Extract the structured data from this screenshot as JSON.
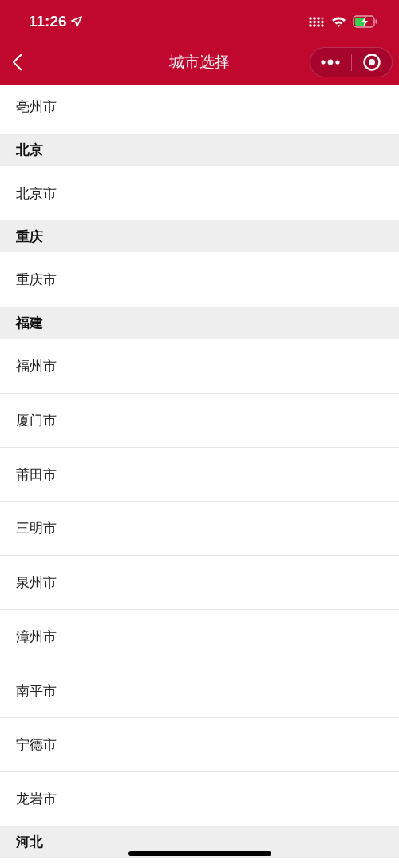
{
  "status_bar": {
    "time": "11:26"
  },
  "nav": {
    "title": "城市选择"
  },
  "groups": [
    {
      "cities": [
        "亳州市"
      ]
    },
    {
      "province": "北京",
      "cities": [
        "北京市"
      ]
    },
    {
      "province": "重庆",
      "cities": [
        "重庆市"
      ]
    },
    {
      "province": "福建",
      "cities": [
        "福州市",
        "厦门市",
        "莆田市",
        "三明市",
        "泉州市",
        "漳州市",
        "南平市",
        "宁德市",
        "龙岩市"
      ]
    },
    {
      "province": "河北"
    }
  ]
}
